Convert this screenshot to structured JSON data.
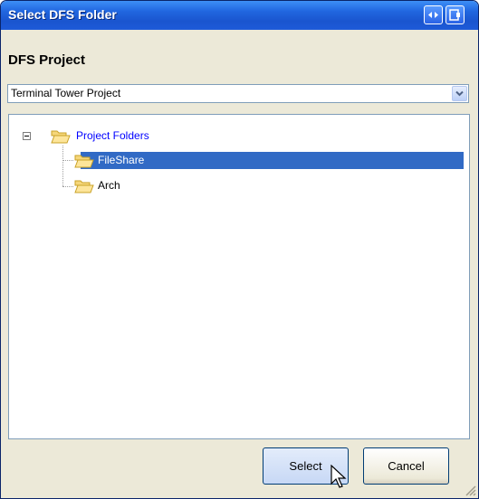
{
  "window": {
    "title": "Select DFS Folder"
  },
  "project": {
    "label": "DFS Project",
    "selected": "Terminal Tower Project"
  },
  "tree": {
    "root": {
      "label": "Project Folders",
      "expanded": true
    },
    "children": [
      {
        "label": "FileShare",
        "selected": true
      },
      {
        "label": "Arch",
        "selected": false
      }
    ]
  },
  "buttons": {
    "select": "Select",
    "cancel": "Cancel"
  },
  "colors": {
    "titlebar": "#2167e0",
    "selection": "#316ac5",
    "root_link": "#0000ff",
    "dialog_bg": "#ece9d8"
  }
}
